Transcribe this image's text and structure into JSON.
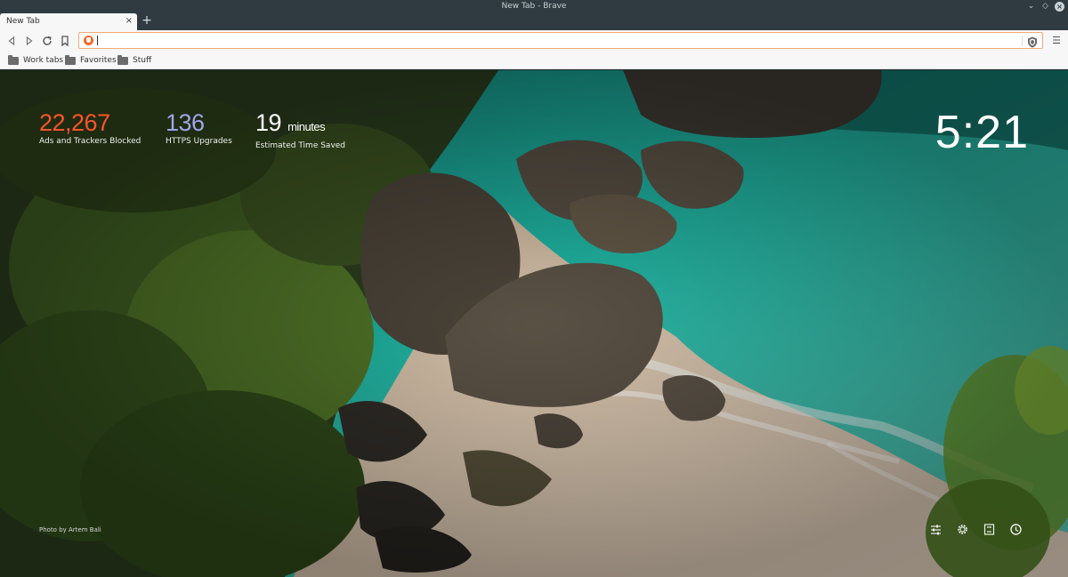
{
  "window": {
    "title": "New Tab - Brave"
  },
  "tabs": [
    {
      "label": "New Tab",
      "active": true
    }
  ],
  "toolbar": {
    "url_value": "",
    "url_placeholder": ""
  },
  "bookmarks": [
    {
      "label": "Work tabs",
      "icon": "folder-icon"
    },
    {
      "label": "Favorites",
      "icon": "folder-icon"
    },
    {
      "label": "Stuff",
      "icon": "folder-icon"
    }
  ],
  "stats": {
    "ads": {
      "value": "22,267",
      "label": "Ads and Trackers Blocked",
      "color": "#fb542b"
    },
    "https": {
      "value": "136",
      "label": "HTTPS Upgrades",
      "color": "#a0a5eb"
    },
    "time": {
      "value": "19",
      "unit": "minutes",
      "label": "Estimated Time Saved",
      "color": "#ffffff"
    }
  },
  "clock": "5:21",
  "photo_credit": "Photo by Artem Bali",
  "footer_icons": [
    "sliders-icon",
    "gear-icon",
    "bookmark-save-icon",
    "history-icon"
  ]
}
